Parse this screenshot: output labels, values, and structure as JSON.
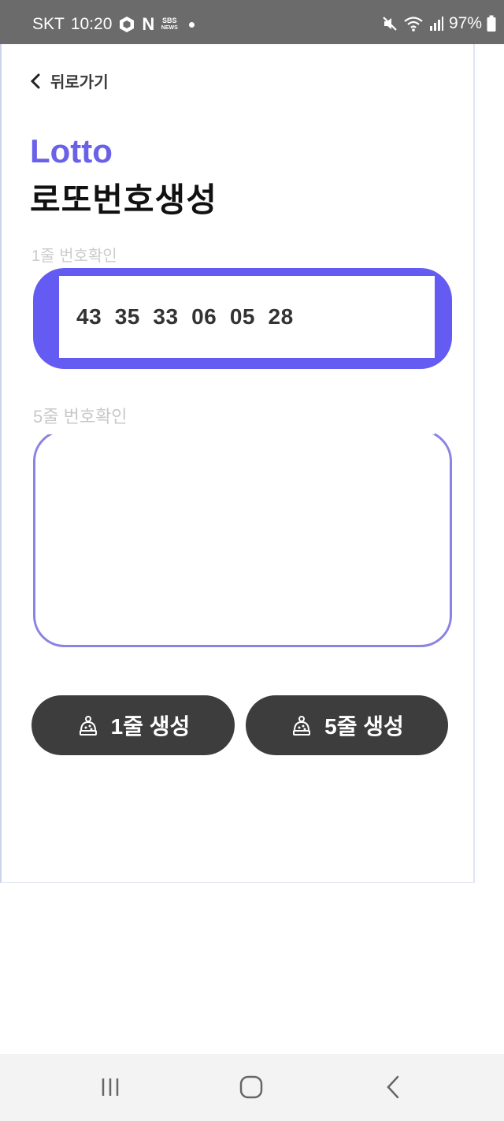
{
  "status_bar": {
    "carrier": "SKT",
    "time": "10:20",
    "notification_app_n": "N",
    "sbs_top": "SBS",
    "sbs_bottom": "NEWS",
    "battery": "97%"
  },
  "header": {
    "back_label": "뒤로가기",
    "brand": "Lotto",
    "title": "로또번호생성"
  },
  "main": {
    "section1_label": "1줄 번호확인",
    "numbers_1": "43  35  33  06  05  28",
    "section2_label": "5줄 번호확인",
    "numbers_5": ""
  },
  "buttons": {
    "gen1_label": "1줄 생성",
    "gen5_label": "5줄 생성"
  },
  "colors": {
    "accent": "#645bf2",
    "button_bg": "#3d3d3d",
    "status_bar_bg": "#6b6b6b"
  }
}
